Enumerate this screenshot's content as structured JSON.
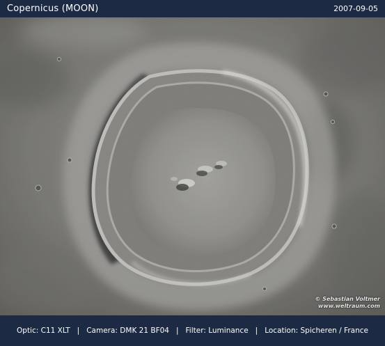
{
  "header": {
    "title": "Copernicus (MOON)",
    "date": "2007-09-05"
  },
  "photo": {
    "subject": "lunar-crater",
    "credit_line1": "© Sebastian Voltmer",
    "credit_line2": "www.weltraum.com"
  },
  "footer": {
    "separator": "|",
    "items": [
      "Optic: C11 XLT",
      "Camera: DMK 21 BF04",
      "Filter: Luminance",
      "Location: Spicheren / France"
    ]
  },
  "colors": {
    "frame": "#1c2a44",
    "text": "#ffffff"
  }
}
